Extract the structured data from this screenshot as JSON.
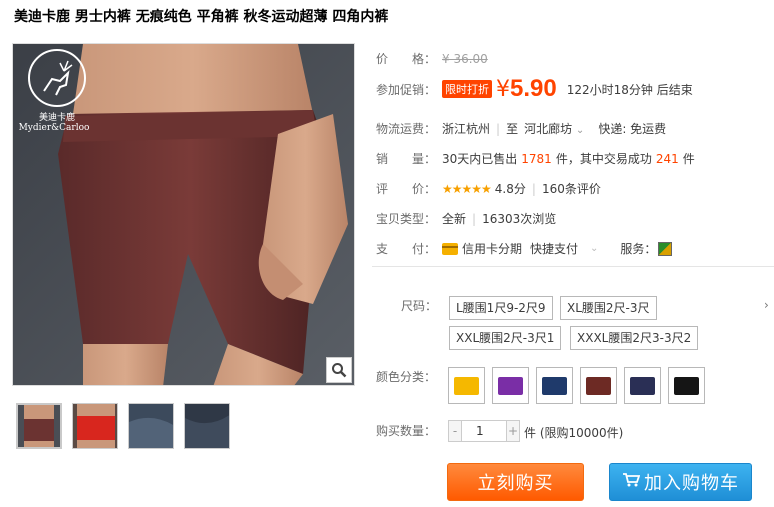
{
  "title": "美迪卡鹿 男士内裤 无痕纯色 平角裤 秋冬运动超薄 四角内裤",
  "brand": {
    "cn": "美迪卡鹿",
    "en": "Mydier&Carloo"
  },
  "price": {
    "label": "价　　格：",
    "original": "¥ 36.00"
  },
  "promo": {
    "label": "参加促销：",
    "tag": "限时打折",
    "currency": "¥",
    "value": "5.90",
    "countdown": "122小时18分钟 后结束"
  },
  "shipping": {
    "label": "物流运费：",
    "from": "浙江杭州",
    "to_word": "至",
    "to": "河北廊坊",
    "arrow": "⌄",
    "express": "快递: 免运费"
  },
  "sales": {
    "label": "销　　量：",
    "prefix": "30天内已售出",
    "sold": "1781",
    "mid": "件，其中交易成功",
    "success": "241",
    "suffix": "件"
  },
  "review": {
    "label": "评　　价：",
    "stars": "★★★★★",
    "score": "4.8分",
    "count": "160条评价"
  },
  "type": {
    "label": "宝贝类型：",
    "condition": "全新",
    "views": "16303次浏览"
  },
  "payment": {
    "label": "支　　付：",
    "credit": "信用卡分期",
    "fast": "快捷支付",
    "service_label": "服务："
  },
  "size": {
    "label": "尺码：",
    "options": [
      "L腰围1尺9-2尺9",
      "XL腰围2尺-3尺",
      "XXL腰围2尺-3尺1",
      "XXXL腰围2尺3-3尺2"
    ]
  },
  "color": {
    "label": "颜色分类：",
    "options": [
      "#f5b800",
      "#7a2ea6",
      "#1f3a6b",
      "#6d2a24",
      "#2a2f55",
      "#151515"
    ]
  },
  "quantity": {
    "label": "购买数量：",
    "value": "1",
    "minus": "-",
    "plus": "+",
    "unit": "件 (限购10000件)"
  },
  "buttons": {
    "buy": "立刻购买",
    "cart": "加入购物车"
  },
  "colors": {
    "accent": "#ff4400",
    "buy": "#ff6a00",
    "cart": "#2aa0e6"
  }
}
